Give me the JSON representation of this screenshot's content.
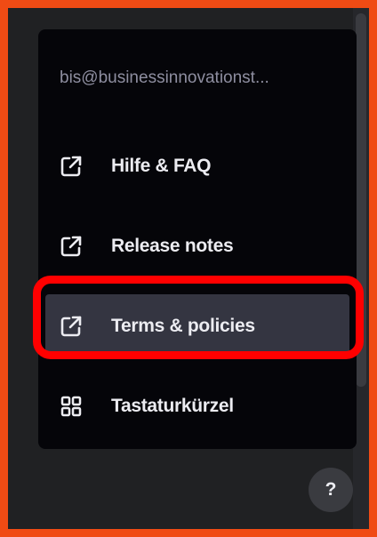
{
  "account": {
    "email": "bis@businessinnovationst..."
  },
  "menu": {
    "items": [
      {
        "label": "Hilfe & FAQ",
        "icon": "external-link-icon",
        "selected": false
      },
      {
        "label": "Release notes",
        "icon": "external-link-icon",
        "selected": false
      },
      {
        "label": "Terms & policies",
        "icon": "external-link-icon",
        "selected": true
      },
      {
        "label": "Tastaturkürzel",
        "icon": "grid-icon",
        "selected": false
      }
    ]
  },
  "help_button": {
    "label": "?"
  },
  "colors": {
    "frame_border": "#f04b14",
    "annotation_box": "#ff0000",
    "background": "#202123",
    "menu_background": "#050509",
    "selected_item_background": "#343541",
    "text": "#ececf1",
    "muted_text": "#8e8ea0"
  }
}
